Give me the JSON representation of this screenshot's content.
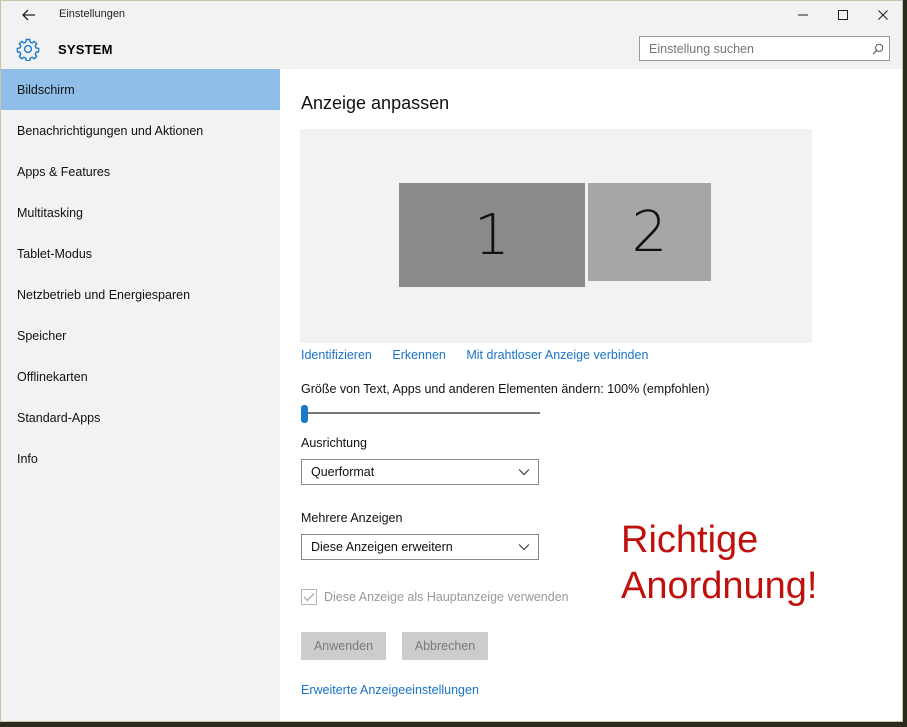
{
  "window": {
    "title": "Einstellungen"
  },
  "header": {
    "section": "SYSTEM",
    "search_placeholder": "Einstellung suchen"
  },
  "sidebar": {
    "items": [
      {
        "label": "Bildschirm",
        "active": true
      },
      {
        "label": "Benachrichtigungen und Aktionen"
      },
      {
        "label": "Apps & Features"
      },
      {
        "label": "Multitasking"
      },
      {
        "label": "Tablet-Modus"
      },
      {
        "label": "Netzbetrieb und Energiesparen"
      },
      {
        "label": "Speicher"
      },
      {
        "label": "Offlinekarten"
      },
      {
        "label": "Standard-Apps"
      },
      {
        "label": "Info"
      }
    ]
  },
  "main": {
    "heading": "Anzeige anpassen",
    "monitors": [
      "1",
      "2"
    ],
    "links": {
      "identify": "Identifizieren",
      "detect": "Erkennen",
      "wireless": "Mit drahtloser Anzeige verbinden"
    },
    "scale_label": "Größe von Text, Apps und anderen Elementen ändern: 100% (empfohlen)",
    "scale_value": 0,
    "orientation_label": "Ausrichtung",
    "orientation_value": "Querformat",
    "multi_label": "Mehrere Anzeigen",
    "multi_value": "Diese Anzeigen erweitern",
    "main_display_checkbox": "Diese Anzeige als Hauptanzeige verwenden",
    "apply_button": "Anwenden",
    "cancel_button": "Abbrechen",
    "advanced_link": "Erweiterte Anzeigeeinstellungen"
  },
  "annotation": {
    "text": "Richtige\nAnordnung!",
    "color": "#c0100c"
  },
  "colors": {
    "accent": "#1979ca",
    "selected_nav": "#8fbfe9",
    "link": "#1a73c8"
  }
}
